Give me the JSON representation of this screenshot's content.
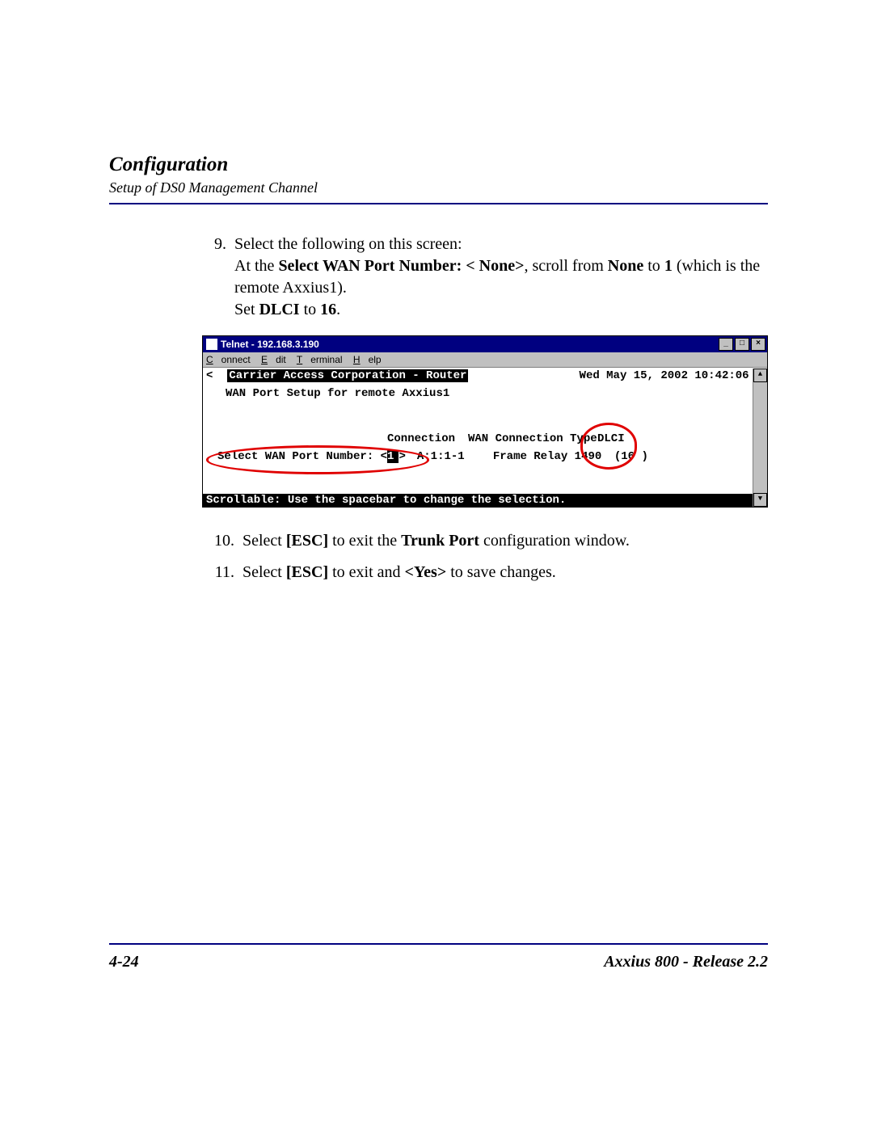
{
  "header": {
    "title": "Configuration",
    "subtitle": "Setup of DS0 Management Channel"
  },
  "steps": {
    "s9": {
      "num": "9.",
      "line1": "Select the following on this screen:",
      "line2a": "At the ",
      "line2b": "Select WAN Port Number: < None>",
      "line2c": ", scroll from ",
      "line2d": "None",
      "line2e": " to ",
      "line2f": "1",
      "line2g": " (which is the remote Axxius1).",
      "line3a": "Set ",
      "line3b": "DLCI",
      "line3c": " to ",
      "line3d": "16",
      "line3e": "."
    },
    "s10": {
      "num": "10.",
      "a": "Select ",
      "b": "[ESC]",
      "c": " to exit the ",
      "d": "Trunk Port",
      "e": " configuration window."
    },
    "s11": {
      "num": "11.",
      "a": "Select ",
      "b": "[ESC]",
      "c": " to exit and ",
      "d": "<Yes>",
      "e": " to save changes."
    }
  },
  "telnet": {
    "title": "Telnet - 192.168.3.190",
    "menu": {
      "connect": "Connect",
      "edit": "Edit",
      "terminal": "Terminal",
      "help": "Help"
    },
    "header_left": "Carrier Access Corporation - Router",
    "header_right": "Wed May 15, 2002 10:42:06",
    "subtitle": "WAN Port Setup for remote Axxius1",
    "col_connection": "Connection",
    "col_wantype": "WAN Connection Type",
    "col_dlci": "DLCI",
    "row_label": "Select WAN Port Number: <",
    "row_val1": "1",
    "row_gt": ">",
    "row_conn": "A:1:1-1",
    "row_type": "Frame Relay 1490",
    "row_dlci": "(16  )",
    "status": "Scrollable: Use the spacebar to change the selection.",
    "left_arrow": "<",
    "right_arrow": ">",
    "min": "_",
    "max": "□",
    "close": "×",
    "up": "▲",
    "down": "▼"
  },
  "footer": {
    "page": "4-24",
    "product": "Axxius 800 - Release 2.2"
  }
}
